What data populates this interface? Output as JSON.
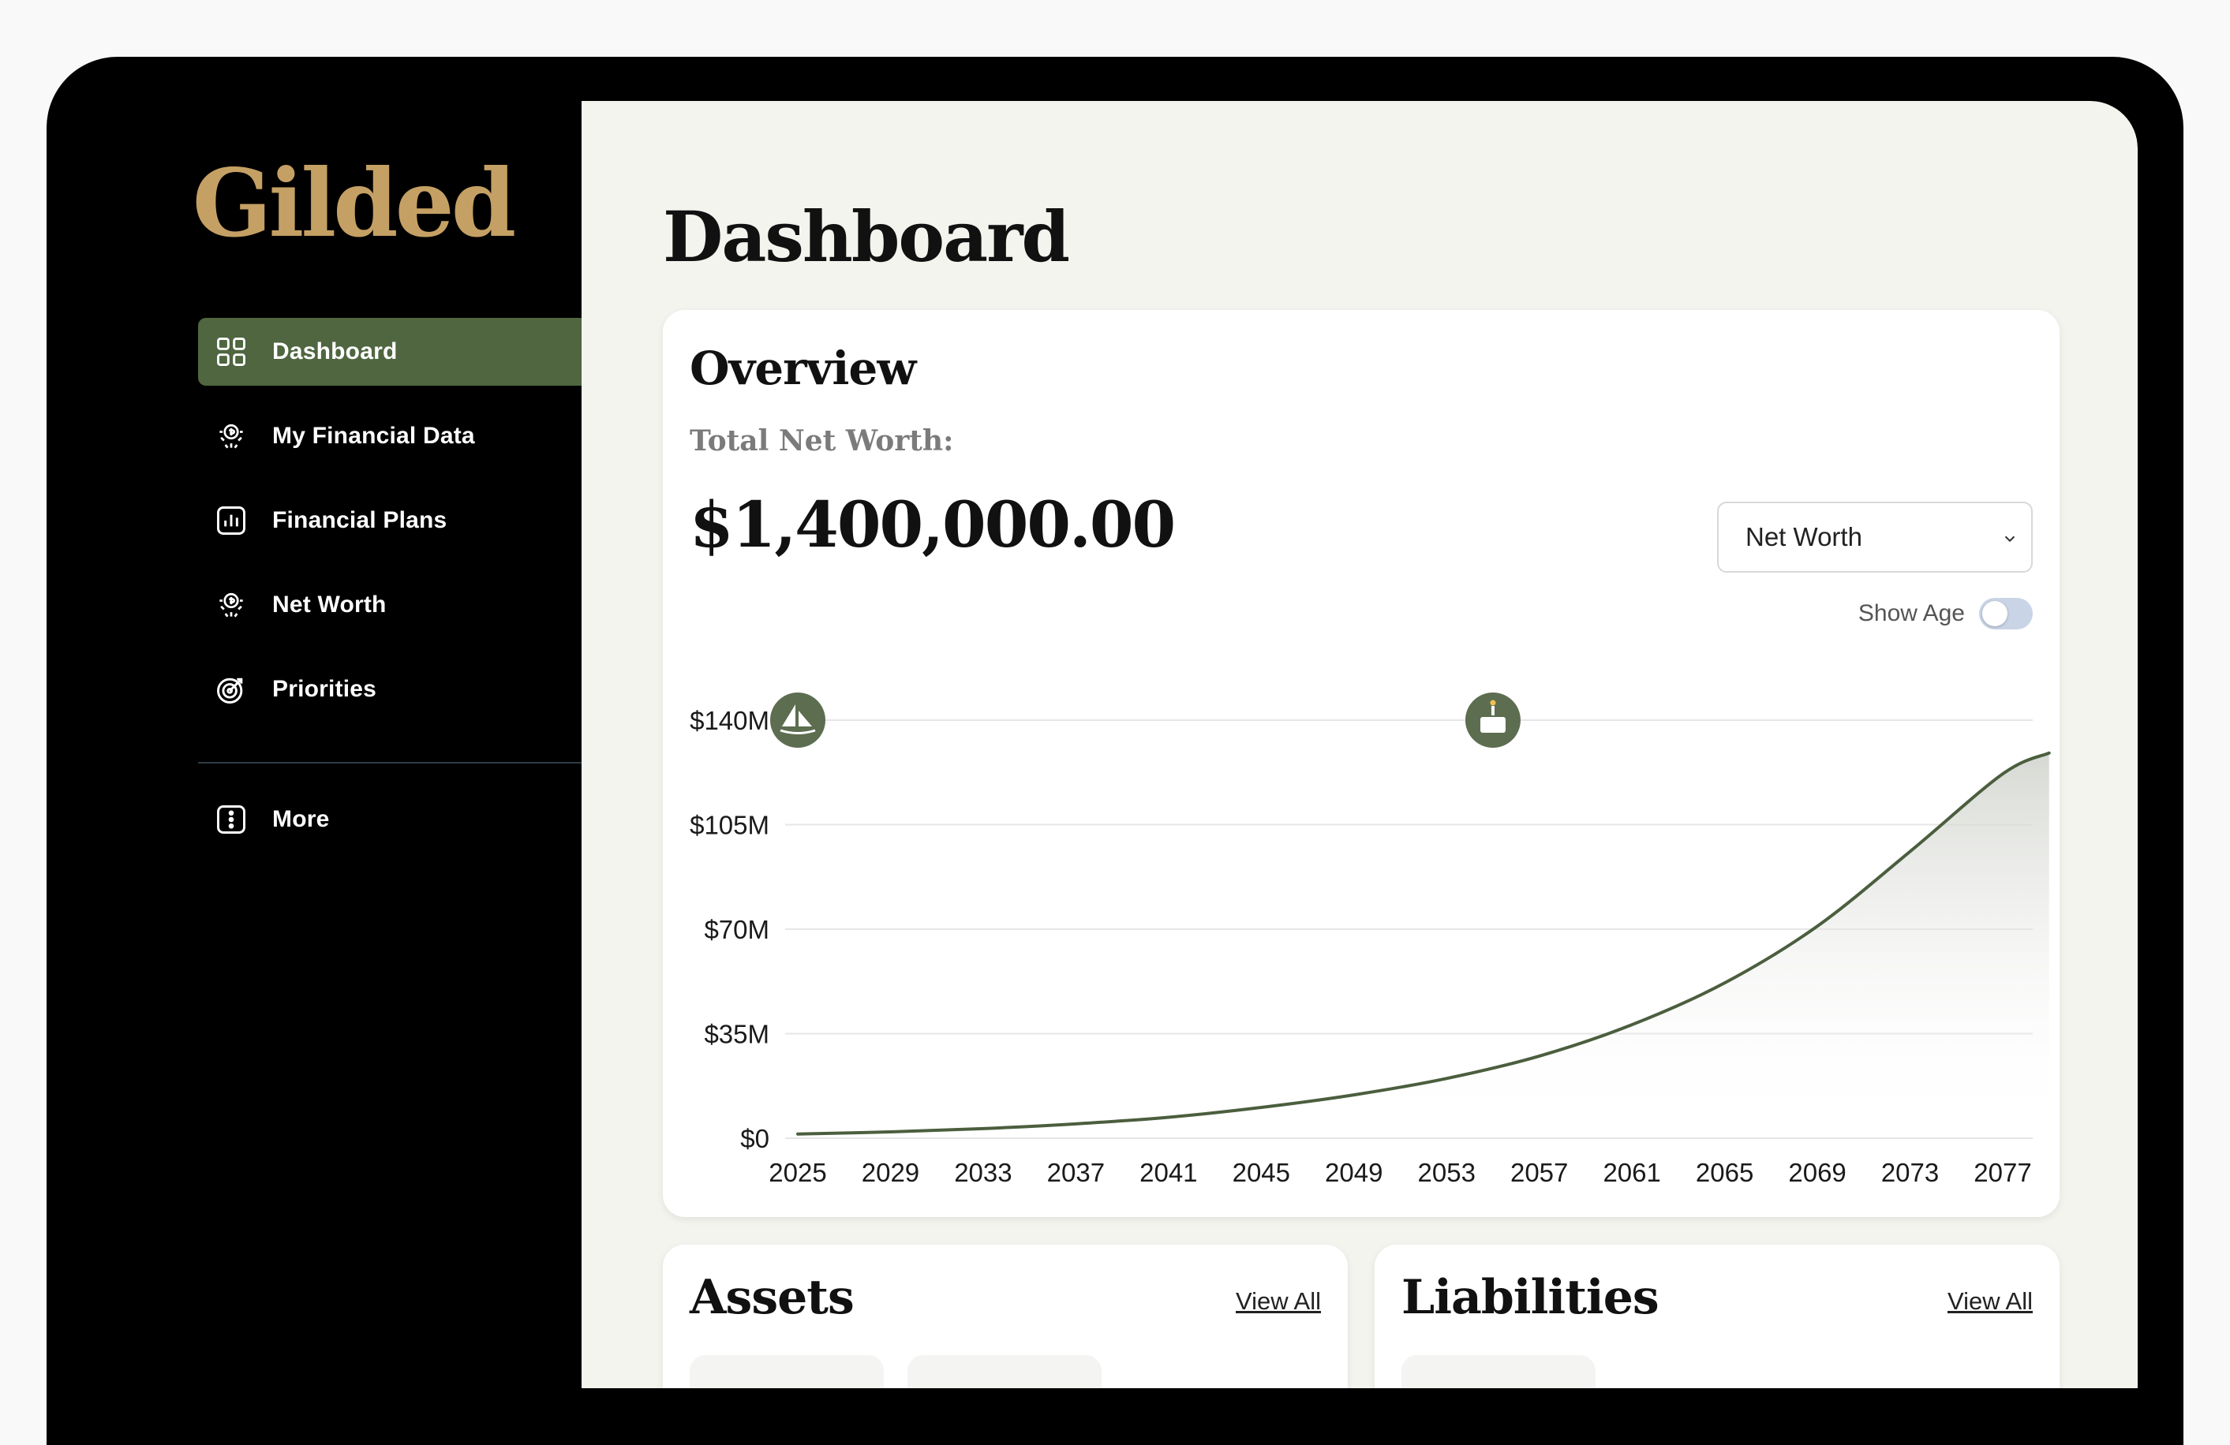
{
  "brand": {
    "name": "Gilded",
    "color": "#c5a064"
  },
  "sidebar": {
    "items": [
      {
        "label": "Dashboard",
        "icon": "grid-icon",
        "active": true
      },
      {
        "label": "My Financial Data",
        "icon": "money-hand-icon",
        "has_chevron": true
      },
      {
        "label": "Financial Plans",
        "icon": "bar-chart-icon"
      },
      {
        "label": "Net Worth",
        "icon": "money-hand-icon"
      },
      {
        "label": "Priorities",
        "icon": "target-icon"
      }
    ],
    "more": {
      "label": "More",
      "icon": "more-vertical-icon",
      "has_chevron": true
    }
  },
  "header": {
    "title": "Dashboard"
  },
  "overview": {
    "title": "Overview",
    "net_worth_label": "Total Net Worth:",
    "net_worth_value": "$1,400,000.00",
    "select": {
      "value": "Net Worth"
    },
    "toggle": {
      "label": "Show Age",
      "checked": false
    }
  },
  "chart_data": {
    "type": "area",
    "title": "",
    "xlabel": "",
    "ylabel": "",
    "ylim": [
      0,
      140000000
    ],
    "yticks": [
      "$0",
      "$35M",
      "$70M",
      "$105M",
      "$140M"
    ],
    "xticks": [
      "2025",
      "2029",
      "2033",
      "2037",
      "2041",
      "2045",
      "2049",
      "2053",
      "2057",
      "2061",
      "2065",
      "2069",
      "2073",
      "2077"
    ],
    "grid": true,
    "line_color": "#4b5e3e",
    "x": [
      2025,
      2029,
      2033,
      2037,
      2041,
      2045,
      2049,
      2053,
      2057,
      2061,
      2065,
      2069,
      2073,
      2077,
      2079
    ],
    "values": [
      1400000,
      2100000,
      3200000,
      4800000,
      7000000,
      10300000,
      14500000,
      20000000,
      27500000,
      38000000,
      52000000,
      71000000,
      96000000,
      122000000,
      129000000
    ],
    "markers": [
      {
        "x": 2025,
        "icon": "sailboat-icon"
      },
      {
        "x": 2055,
        "icon": "cake-icon"
      }
    ]
  },
  "assets": {
    "title": "Assets",
    "view_all": "View All"
  },
  "liabilities": {
    "title": "Liabilities",
    "view_all": "View All"
  }
}
